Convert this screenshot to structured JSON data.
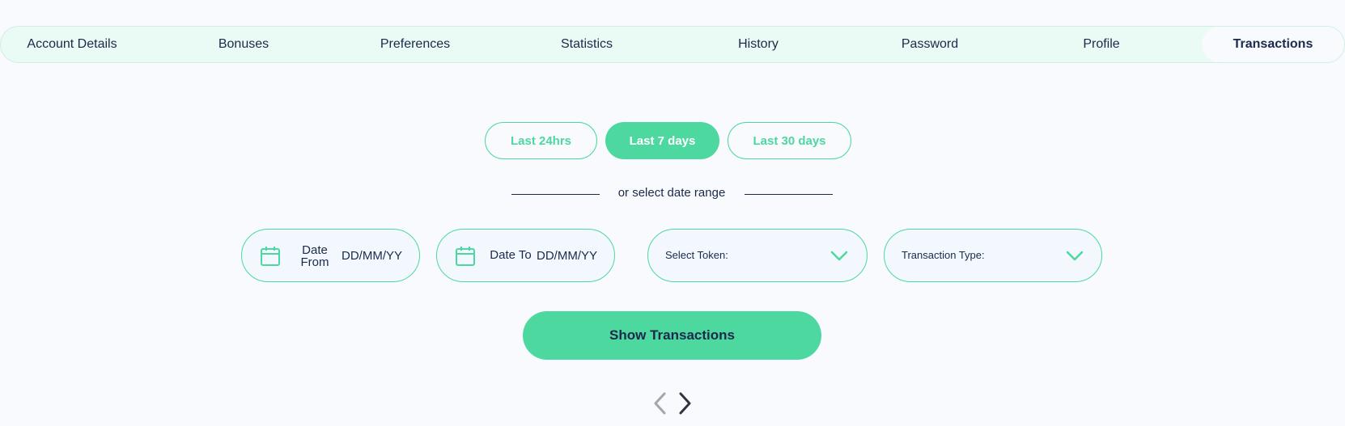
{
  "tabs": [
    {
      "label": "Account Details"
    },
    {
      "label": "Bonuses"
    },
    {
      "label": "Preferences"
    },
    {
      "label": "Statistics"
    },
    {
      "label": "History"
    },
    {
      "label": "Password"
    },
    {
      "label": "Profile"
    },
    {
      "label": "Transactions",
      "active": true
    }
  ],
  "quick_ranges": [
    {
      "label": "Last 24hrs",
      "selected": false
    },
    {
      "label": "Last 7 days",
      "selected": true
    },
    {
      "label": "Last 30 days",
      "selected": false
    }
  ],
  "divider_text": "or select date range",
  "filters": {
    "date_from": {
      "label": "Date From",
      "value": "DD/MM/YY",
      "icon": "calendar-icon"
    },
    "date_to": {
      "label": "Date To",
      "value": "DD/MM/YY",
      "icon": "calendar-icon"
    },
    "token": {
      "label": "Select Token:",
      "icon": "chevron-down-icon"
    },
    "transaction_type": {
      "label": "Transaction Type:",
      "icon": "chevron-down-icon"
    }
  },
  "show_button_label": "Show Transactions",
  "pagination": {
    "prev_icon": "chevron-left-icon",
    "next_icon": "chevron-right-icon"
  },
  "colors": {
    "accent": "#4dd89f",
    "text": "#1b2a4a",
    "background": "#f8fafe",
    "tabbar": "#eafaf4"
  }
}
